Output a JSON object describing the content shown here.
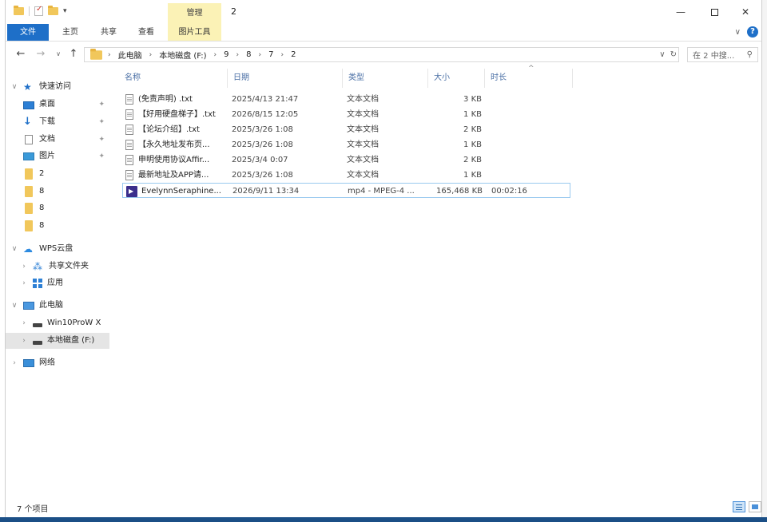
{
  "window": {
    "title": "2",
    "context_tab_group": "管理",
    "min_label": "—",
    "close_label": "✕"
  },
  "ribbon": {
    "file": "文件",
    "home": "主页",
    "share": "共享",
    "view": "查看",
    "picture_tools": "图片工具",
    "help": "?"
  },
  "address": {
    "crumbs": [
      "此电脑",
      "本地磁盘 (F:)",
      "9",
      "8",
      "7",
      "2"
    ],
    "refresh": "↻",
    "dropdown": "∨"
  },
  "search": {
    "placeholder": "在 2 中搜...",
    "icon": "search-icon"
  },
  "nav": {
    "quick_access": "快速访问",
    "desktop": "桌面",
    "downloads": "下载",
    "documents": "文档",
    "pictures": "图片",
    "folder_2": "2",
    "folder_8a": "8",
    "folder_8b": "8",
    "folder_8c": "8",
    "wps_cloud": "WPS云盘",
    "shared_folder": "共享文件夹",
    "apps": "应用",
    "this_pc": "此电脑",
    "drive_c": "Win10ProW X",
    "drive_f": "本地磁盘 (F:)",
    "network": "网络"
  },
  "columns": {
    "name": "名称",
    "date": "日期",
    "type": "类型",
    "size": "大小",
    "duration": "时长"
  },
  "files": [
    {
      "name": "(免责声明) .txt",
      "date": "2025/4/13 21:47",
      "type": "文本文档",
      "size": "3 KB",
      "duration": "",
      "icon": "text-file-icon"
    },
    {
      "name": "【好用硬盘梯子】.txt",
      "date": "2026/8/15 12:05",
      "type": "文本文档",
      "size": "1 KB",
      "duration": "",
      "icon": "text-file-icon"
    },
    {
      "name": "【论坛介绍】.txt",
      "date": "2025/3/26 1:08",
      "type": "文本文档",
      "size": "2 KB",
      "duration": "",
      "icon": "text-file-icon"
    },
    {
      "name": "【永久地址发布页...",
      "date": "2025/3/26 1:08",
      "type": "文本文档",
      "size": "1 KB",
      "duration": "",
      "icon": "text-file-icon"
    },
    {
      "name": "申明使用协议Affir...",
      "date": "2025/3/4 0:07",
      "type": "文本文档",
      "size": "2 KB",
      "duration": "",
      "icon": "text-file-icon"
    },
    {
      "name": "最新地址及APP请...",
      "date": "2025/3/26 1:08",
      "type": "文本文档",
      "size": "1 KB",
      "duration": "",
      "icon": "text-file-icon"
    },
    {
      "name": "EvelynnSeraphine...",
      "date": "2026/9/11 13:34",
      "type": "mp4 - MPEG-4 ...",
      "size": "165,468 KB",
      "duration": "00:02:16",
      "icon": "video-file-icon"
    }
  ],
  "status": {
    "item_count": "7 个项目"
  }
}
